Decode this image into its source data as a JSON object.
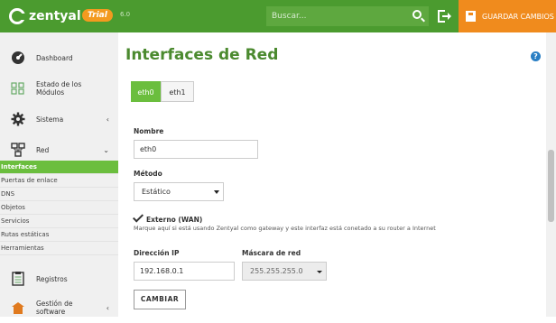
{
  "header": {
    "brand": "zentyal",
    "edition_badge": "Trial",
    "version": "6.0",
    "search_placeholder": "Buscar...",
    "save_label": "GUARDAR CAMBIOS"
  },
  "sidebar": {
    "items": [
      {
        "label": "Dashboard",
        "icon": "dashboard-icon"
      },
      {
        "label": "Estado de los\nMódulos",
        "icon": "modules-icon"
      },
      {
        "label": "Sistema",
        "icon": "gear-icon",
        "chevron": "‹"
      },
      {
        "label": "Red",
        "icon": "network-icon",
        "chevron": "⌄"
      }
    ],
    "subitems": [
      "Interfaces",
      "Puertas de enlace",
      "DNS",
      "Objetos",
      "Servicios",
      "Rutas estáticas",
      "Herramientas"
    ],
    "active_subitem": "Interfaces",
    "more_items": [
      {
        "label": "Registros",
        "icon": "logs-icon"
      },
      {
        "label": "Gestión de\nsoftware",
        "icon": "software-icon",
        "chevron": "‹"
      }
    ]
  },
  "main": {
    "title": "Interfaces de Red",
    "help": "?",
    "tabs": [
      "eth0",
      "eth1"
    ],
    "active_tab": "eth0",
    "form": {
      "name_label": "Nombre",
      "name_value": "eth0",
      "method_label": "Método",
      "method_value": "Estático",
      "external_label": "Externo (WAN)",
      "external_checked": true,
      "external_help": "Marque aquí si está usando Zentyal como gateway y este interfaz está conetado a su router a Internet",
      "ip_label": "Dirección IP",
      "ip_value": "192.168.0.1",
      "mask_label": "Máscara de red",
      "mask_value": "255.255.255.0",
      "submit_label": "CAMBIAR"
    }
  },
  "colors": {
    "header_green": "#4b9b2f",
    "accent_green": "#6bbe3e",
    "title_green": "#4b8a2f",
    "save_orange": "#f08b1d",
    "trial_orange": "#f39a1f"
  }
}
